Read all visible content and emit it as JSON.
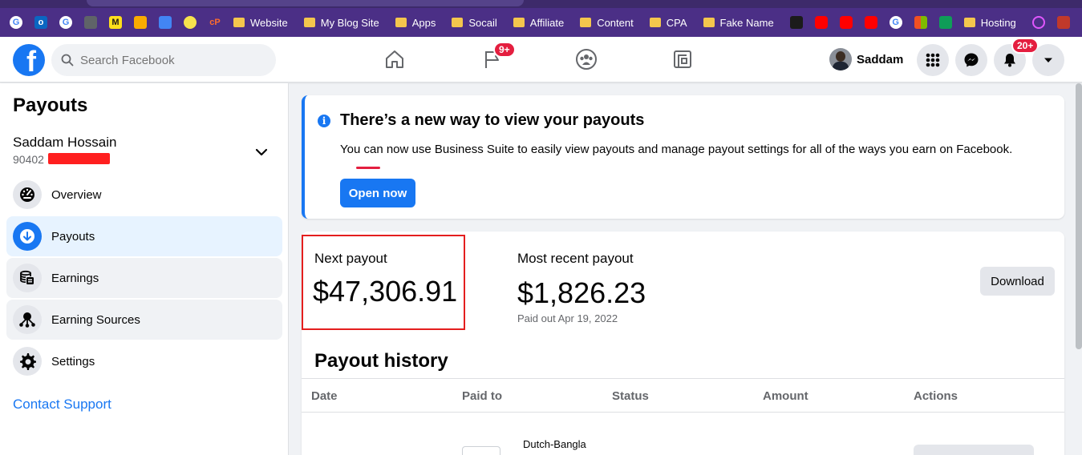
{
  "bookmarks": {
    "folders": [
      "Website",
      "My Blog Site",
      "Apps",
      "Socail",
      "Affiliate",
      "Content",
      "CPA",
      "Fake Name",
      "Hosting"
    ]
  },
  "header": {
    "search_placeholder": "Search Facebook",
    "groups_badge": "9+",
    "profile_name": "Saddam",
    "notifications_badge": "20+"
  },
  "sidebar": {
    "title": "Payouts",
    "account_name": "Saddam Hossain",
    "account_id_prefix": "90402",
    "items": [
      {
        "label": "Overview",
        "icon": "dashboard-icon"
      },
      {
        "label": "Payouts",
        "icon": "download-arrow-icon"
      },
      {
        "label": "Earnings",
        "icon": "coins-stack-icon"
      },
      {
        "label": "Earning Sources",
        "icon": "hierarchy-icon"
      },
      {
        "label": "Settings",
        "icon": "gear-icon"
      }
    ],
    "contact_support": "Contact Support"
  },
  "info_banner": {
    "title": "There’s a new way to view your payouts",
    "text": "You can now use Business Suite to easily view payouts and manage payout settings for all of the ways you earn on Facebook.",
    "button": "Open now"
  },
  "payouts": {
    "next_label": "Next payout",
    "next_value": "$47,306.91",
    "recent_label": "Most recent payout",
    "recent_value": "$1,826.23",
    "recent_date": "Paid out Apr 19, 2022",
    "download_button": "Download"
  },
  "history": {
    "title": "Payout history",
    "columns": [
      "Date",
      "Paid to",
      "Status",
      "Amount",
      "Actions"
    ],
    "rows": [
      {
        "paid_to": "Dutch-Bangla"
      }
    ]
  },
  "colors": {
    "brand": "#1877f2",
    "badge": "#e41e3f",
    "highlight_border": "#e41e1e"
  }
}
